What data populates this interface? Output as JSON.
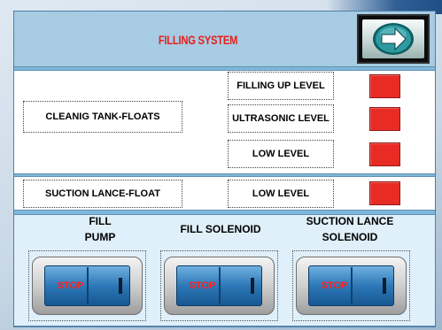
{
  "header": {
    "title": "FILLING SYSTEM"
  },
  "nav": {
    "icon": "arrow-right-icon"
  },
  "cleaning_tank": {
    "label": "CLEANIG TANK-FLOATS",
    "levels": [
      {
        "label": "FILLING UP LEVEL",
        "status_color": "#e92b26"
      },
      {
        "label": "ULTRASONIC LEVEL",
        "status_color": "#e92b26"
      },
      {
        "label": "LOW LEVEL",
        "status_color": "#e92b26"
      }
    ]
  },
  "suction_lance": {
    "label": "SUCTION LANCE-FLOAT",
    "level": {
      "label": "LOW LEVEL",
      "status_color": "#e92b26"
    }
  },
  "controls": [
    {
      "label_line1": "FILL",
      "label_line2": "PUMP",
      "switch_text": "STOP"
    },
    {
      "label_line1": "FILL SOLENOID",
      "label_line2": "",
      "switch_text": "STOP"
    },
    {
      "label_line1": "SUCTION LANCE",
      "label_line2": "SOLENOID",
      "switch_text": "STOP"
    }
  ]
}
